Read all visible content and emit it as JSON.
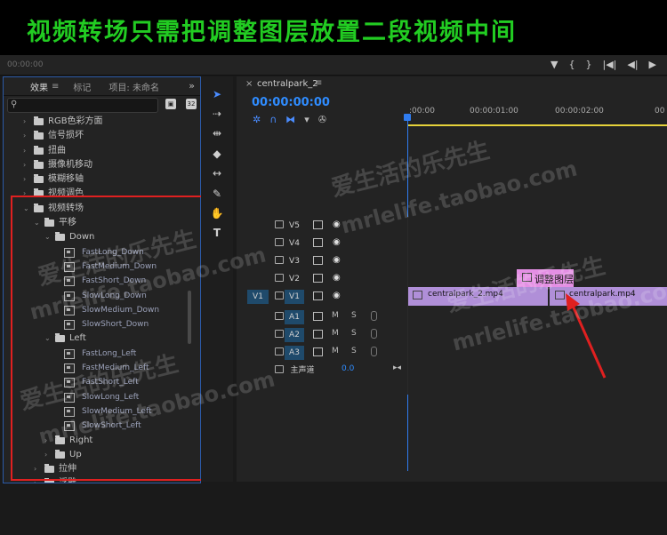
{
  "banner": {
    "title": "视频转场只需把调整图层放置二段视频中间"
  },
  "top": {
    "timecode_left": "00:00:00",
    "right_icons": [
      "▼",
      "{",
      "}",
      "|◀|",
      "◀|",
      "▶"
    ]
  },
  "effects_panel": {
    "tabs": [
      "效果",
      "标记",
      "项目: 未命名"
    ],
    "more": "»",
    "tree": [
      {
        "label": "RGB色彩方面",
        "indent": 0,
        "kind": "folder",
        "open": false
      },
      {
        "label": "信号损坏",
        "indent": 0,
        "kind": "folder",
        "open": false
      },
      {
        "label": "扭曲",
        "indent": 0,
        "kind": "folder",
        "open": false
      },
      {
        "label": "摄像机移动",
        "indent": 0,
        "kind": "folder",
        "open": false
      },
      {
        "label": "模糊移轴",
        "indent": 0,
        "kind": "folder",
        "open": false
      },
      {
        "label": "视频调色",
        "indent": 0,
        "kind": "folder",
        "open": false
      },
      {
        "label": "视频转场",
        "indent": 0,
        "kind": "folder",
        "open": true
      },
      {
        "label": "平移",
        "indent": 1,
        "kind": "folder",
        "open": true
      },
      {
        "label": "Down",
        "indent": 2,
        "kind": "folder",
        "open": true
      },
      {
        "label": "FastLong_Down",
        "indent": 3,
        "kind": "effect"
      },
      {
        "label": "FastMedium_Down",
        "indent": 3,
        "kind": "effect"
      },
      {
        "label": "FastShort_Down",
        "indent": 3,
        "kind": "effect"
      },
      {
        "label": "SlowLong_Down",
        "indent": 3,
        "kind": "effect"
      },
      {
        "label": "SlowMedium_Down",
        "indent": 3,
        "kind": "effect"
      },
      {
        "label": "SlowShort_Down",
        "indent": 3,
        "kind": "effect"
      },
      {
        "label": "Left",
        "indent": 2,
        "kind": "folder",
        "open": true
      },
      {
        "label": "FastLong_Left",
        "indent": 3,
        "kind": "effect"
      },
      {
        "label": "FastMedium_Left",
        "indent": 3,
        "kind": "effect"
      },
      {
        "label": "FastShort_Left",
        "indent": 3,
        "kind": "effect"
      },
      {
        "label": "SlowLong_Left",
        "indent": 3,
        "kind": "effect"
      },
      {
        "label": "SlowMedium_Left",
        "indent": 3,
        "kind": "effect"
      },
      {
        "label": "SlowShort_Left",
        "indent": 3,
        "kind": "effect"
      },
      {
        "label": "Right",
        "indent": 2,
        "kind": "folder",
        "open": false
      },
      {
        "label": "Up",
        "indent": 2,
        "kind": "folder",
        "open": false
      },
      {
        "label": "拉伸",
        "indent": 1,
        "kind": "folder",
        "open": false
      },
      {
        "label": "浮雕",
        "indent": 1,
        "kind": "folder",
        "open": false
      }
    ]
  },
  "timeline": {
    "sequence_name": "centralpark_2",
    "timecode": "00:00:00:00",
    "ruler": [
      ":00:00",
      "00:00:01:00",
      "00:00:02:00",
      "00"
    ],
    "video_tracks": [
      {
        "name": "V5",
        "target": "",
        "on": false
      },
      {
        "name": "V4",
        "target": "",
        "on": false
      },
      {
        "name": "V3",
        "target": "",
        "on": false
      },
      {
        "name": "V2",
        "target": "",
        "on": false
      },
      {
        "name": "V1",
        "target": "V1",
        "on": true
      }
    ],
    "audio_tracks": [
      {
        "name": "A1",
        "m": "M",
        "s": "S"
      },
      {
        "name": "A2",
        "m": "M",
        "s": "S"
      },
      {
        "name": "A3",
        "m": "M",
        "s": "S"
      }
    ],
    "master": {
      "label": "主声道",
      "value": "0.0"
    },
    "clips": {
      "v1_first": "centralpark_2.mp4",
      "v1_second": "centralpark.mp4",
      "adjustment": "调整图层"
    }
  },
  "watermark": {
    "line1": "爱生活的乐先生",
    "line2": "mrlelife.taobao.com"
  },
  "colors": {
    "accent": "#2f8cff",
    "banner_text": "#22cc22",
    "highlight": "#e02020",
    "clip": "#b08fd8",
    "adjustment": "#e48fe4"
  }
}
